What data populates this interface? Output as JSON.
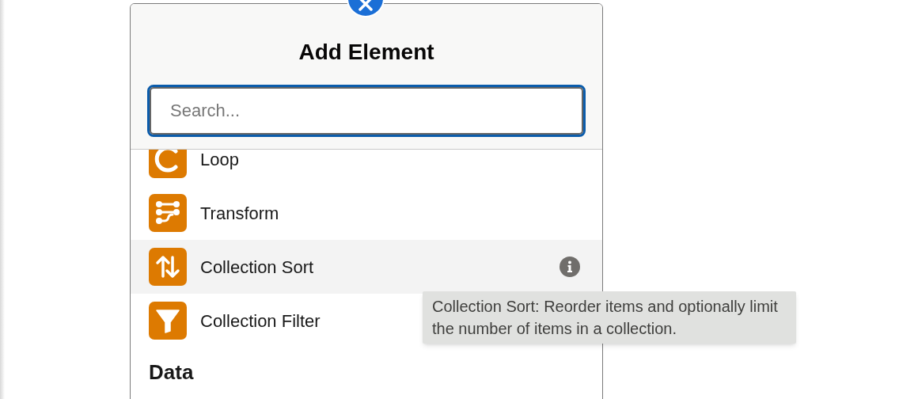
{
  "dialog": {
    "title": "Add Element",
    "search": {
      "placeholder": "Search..."
    },
    "items": [
      {
        "label": "Loop",
        "kind": "loop",
        "selected": false
      },
      {
        "label": "Transform",
        "kind": "transform",
        "selected": false
      },
      {
        "label": "Collection Sort",
        "kind": "sort",
        "selected": true
      },
      {
        "label": "Collection Filter",
        "kind": "filter",
        "selected": false
      }
    ],
    "section": "Data"
  },
  "tooltip": "Collection Sort: Reorder items and optionally limit the number of items in a collection."
}
